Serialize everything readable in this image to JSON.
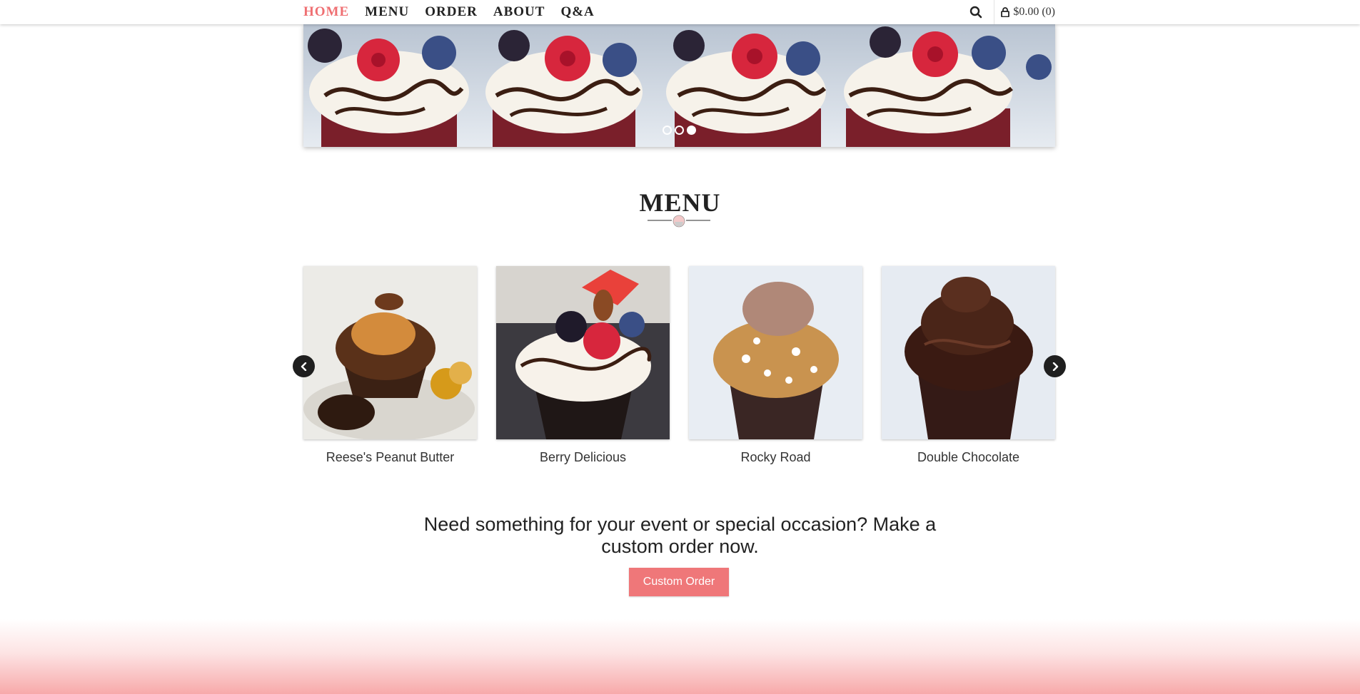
{
  "nav": {
    "links": [
      "HOME",
      "MENU",
      "ORDER",
      "ABOUT",
      "Q&A"
    ],
    "active_index": 0,
    "cart_label": "$0.00 (0)",
    "accent_color": "#ef6f72"
  },
  "hero": {
    "slide_count": 3,
    "active_slide": 3
  },
  "menu_section": {
    "title": "MENU",
    "products": [
      {
        "name": "Reese's Peanut Butter"
      },
      {
        "name": "Berry Delicious"
      },
      {
        "name": "Rocky Road"
      },
      {
        "name": "Double Chocolate"
      }
    ]
  },
  "cta": {
    "text": "Need something for your event or special occasion? Make a custom order now.",
    "button_label": "Custom Order",
    "button_color": "#ef7779"
  },
  "icons": {
    "search": "search-icon",
    "cart": "lock-icon",
    "prev": "chevron-left-icon",
    "next": "chevron-right-icon",
    "divider": "cupcake-icon"
  }
}
